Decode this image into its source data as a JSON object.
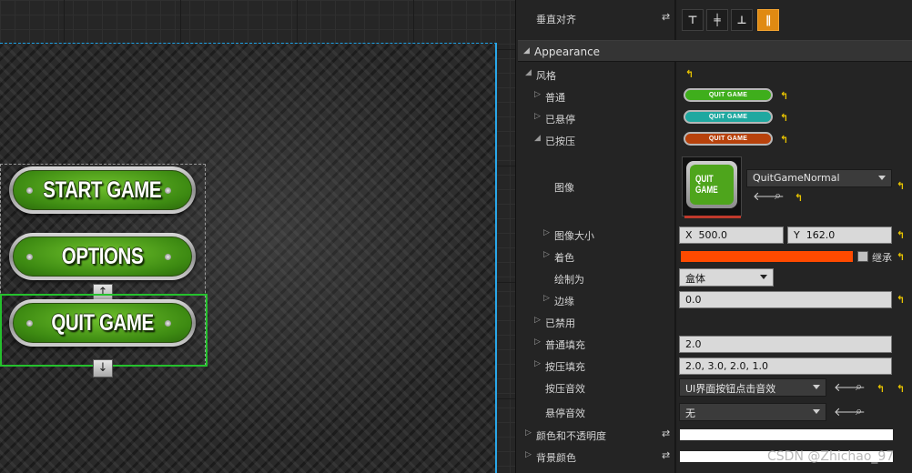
{
  "viewport": {
    "buttons": [
      {
        "label": "START GAME"
      },
      {
        "label": "OPTIONS"
      },
      {
        "label": "QUIT GAME"
      }
    ],
    "arrow_up": "↑",
    "arrow_down": "↓",
    "colors": {
      "selection": "#25c12d",
      "canvas_border": "#1da1e6",
      "button_green": "#4ea51c"
    }
  },
  "details": {
    "vertical_align_label": "垂直对齐",
    "section_title": "Appearance",
    "style_label": "风格",
    "states": [
      {
        "label": "普通",
        "thumb_text": "QUIT GAME",
        "color": "#3fae1c"
      },
      {
        "label": "已悬停",
        "thumb_text": "QUIT GAME",
        "color": "#1fa8a0"
      },
      {
        "label": "已按压",
        "thumb_text": "QUIT GAME",
        "color": "#b8420c"
      }
    ],
    "image": {
      "label": "图像",
      "asset_name": "QuitGameNormal",
      "thumb_text": "QUIT GAME"
    },
    "image_size": {
      "label": "图像大小",
      "x_prefix": "X",
      "x_value": "500.0",
      "y_prefix": "Y",
      "y_value": "162.0"
    },
    "tint": {
      "label": "着色",
      "color": "#ff4a00",
      "inherit_label": "继承"
    },
    "draw_as": {
      "label": "绘制为",
      "value": "盒体"
    },
    "margin": {
      "label": "边缘",
      "value": "0.0"
    },
    "disabled_label": "已禁用",
    "normal_padding": {
      "label": "普通填充",
      "value": "2.0"
    },
    "pressed_padding": {
      "label": "按压填充",
      "value": "2.0, 3.0, 2.0, 1.0"
    },
    "pressed_sound": {
      "label": "按压音效",
      "value": "UI界面按钮点击音效"
    },
    "hovered_sound": {
      "label": "悬停音效",
      "value": "无"
    },
    "color_opacity_label": "颜色和不透明度",
    "background_color_label": "背景颜色",
    "watermark": "CSDN @Zhichao_97"
  }
}
